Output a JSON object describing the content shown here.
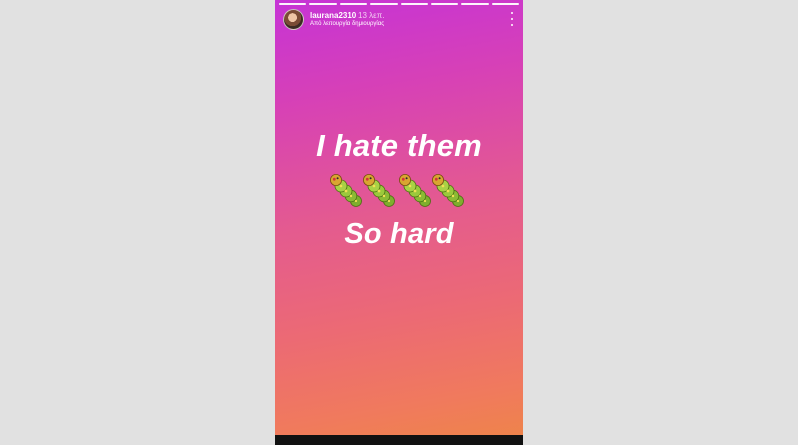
{
  "story": {
    "username": "laurana2310",
    "time_ago": "13 λεπ.",
    "subtitle": "Από λειτουργία δημιουργίας",
    "progress": {
      "segments": 8,
      "current": 8
    },
    "caption": {
      "line1": "I hate them",
      "line2": "So hard"
    },
    "emoji": [
      "caterpillar-emoji",
      "caterpillar-emoji",
      "caterpillar-emoji",
      "caterpillar-emoji"
    ],
    "gradient_colors": [
      "#c633d6",
      "#e45b8f",
      "#ee8548"
    ]
  },
  "icons": {
    "more": "more-vertical-icon"
  }
}
